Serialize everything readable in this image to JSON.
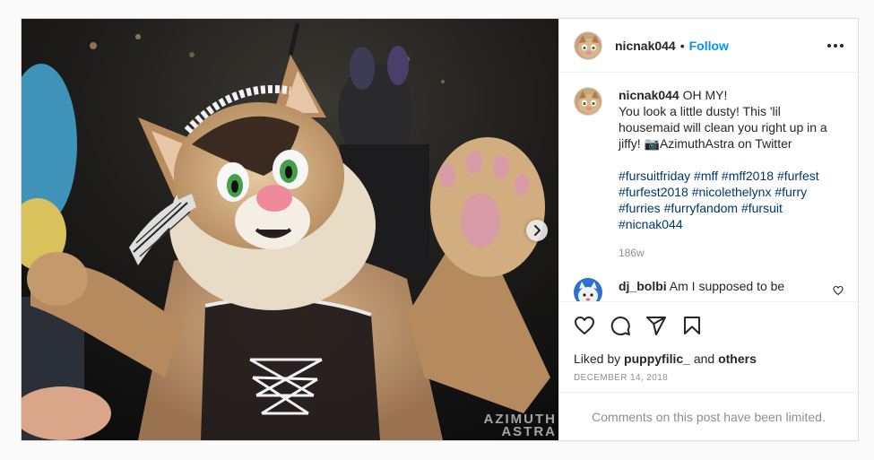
{
  "post": {
    "username": "nicnak044",
    "follow_label": "Follow",
    "separator": "•",
    "watermark_line1": "AZIMUTH",
    "watermark_line2": "ASTRA",
    "caption": {
      "username": "nicnak044",
      "text": "OH MY!\nYou look a little dusty! This 'lil housemaid will clean you right up in a jiffy! 📷AzimuthAstra on Twitter",
      "hashtags": [
        "#fursuitfriday",
        "#mff",
        "#mff2018",
        "#furfest",
        "#furfest2018",
        "#nicolethelynx",
        "#furry",
        "#furries",
        "#furryfandom",
        "#fursuit",
        "#nicnak044"
      ],
      "time": "186w"
    },
    "comment": {
      "username": "dj_bolbi",
      "text": "Am I supposed to be"
    },
    "likes": {
      "prefix": "Liked by",
      "user": "puppyfilic_",
      "joiner": "and",
      "others": "others"
    },
    "date": "DECEMBER 14, 2018",
    "comments_limited": "Comments on this post have been limited."
  },
  "icons": {
    "next": "chevron-right-icon",
    "more": "more-options-icon",
    "like": "heart-icon",
    "comment": "comment-icon",
    "share": "paper-plane-icon",
    "save": "bookmark-icon",
    "comment_like": "heart-icon"
  },
  "colors": {
    "accent": "#0095f6",
    "hashtag": "#00376b",
    "muted": "#8e8e8e",
    "border": "#dbdbdb"
  }
}
